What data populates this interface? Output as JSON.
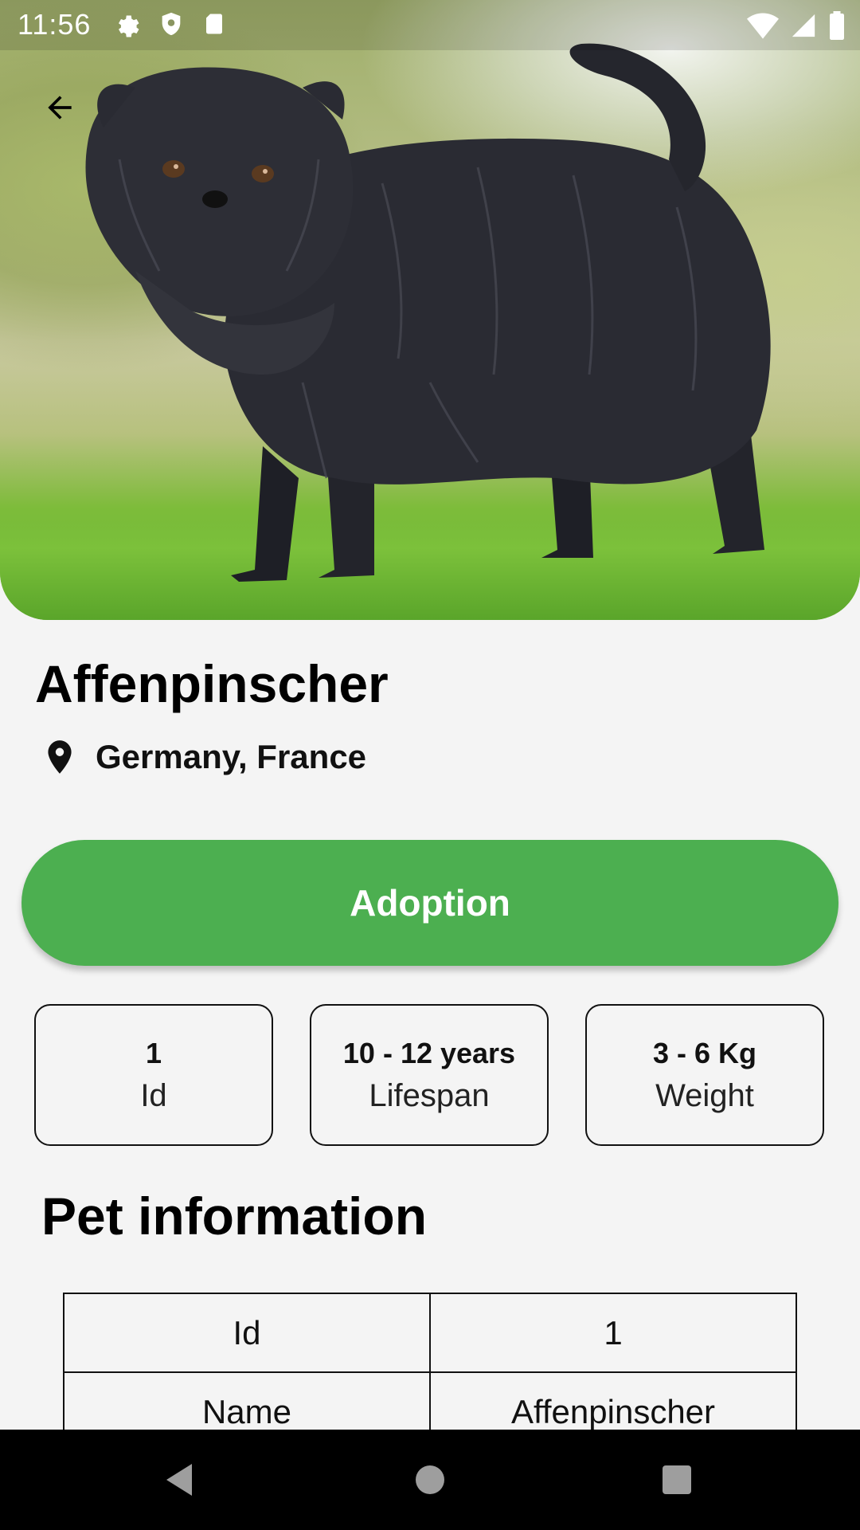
{
  "status_bar": {
    "time": "11:56"
  },
  "pet": {
    "name": "Affenpinscher",
    "origin": "Germany, France"
  },
  "actions": {
    "adoption_label": "Adoption"
  },
  "stats": [
    {
      "value": "1",
      "label": "Id"
    },
    {
      "value": "10 - 12 years",
      "label": "Lifespan"
    },
    {
      "value": "3 - 6 Kg",
      "label": "Weight"
    }
  ],
  "section": {
    "title": "Pet information"
  },
  "info_table": [
    {
      "key": "Id",
      "value": "1"
    },
    {
      "key": "Name",
      "value": "Affenpinscher"
    }
  ],
  "colors": {
    "accent": "#4caf50",
    "background": "#f4f4f4"
  },
  "icons": {
    "back": "arrow-left-icon",
    "location": "location-pin-icon",
    "nav_back": "triangle-back-icon",
    "nav_home": "circle-home-icon",
    "nav_recents": "square-recents-icon"
  }
}
